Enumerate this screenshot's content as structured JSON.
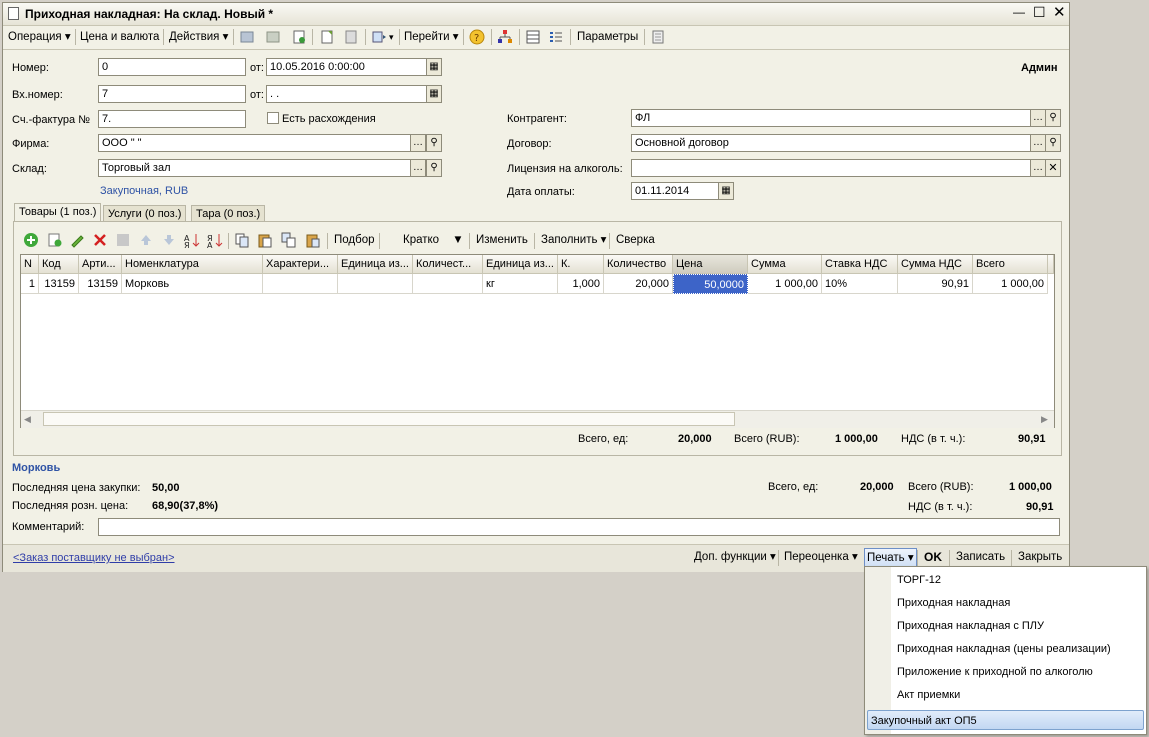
{
  "window": {
    "title": "Приходная накладная: На склад. Новый *"
  },
  "toolbar": {
    "operation": "Операция",
    "price_currency": "Цена и валюта",
    "actions": "Действия",
    "goto": "Перейти",
    "params": "Параметры"
  },
  "user": "Админ",
  "form": {
    "number_label": "Номер:",
    "number_value": "0",
    "from_label": "от:",
    "date_value": "10.05.2016  0:00:00",
    "in_number_label": "Вх.номер:",
    "in_number_value": "7",
    "from2_label": "от:",
    "in_date_value": ". . ",
    "invoice_label": "Сч.-фактура №",
    "invoice_value": "7.",
    "discrepancy_label": "Есть расхождения",
    "firm_label": "Фирма:",
    "firm_value": "ООО \"          \"",
    "warehouse_label": "Склад:",
    "warehouse_value": "Торговый зал",
    "purchase_link": "Закупочная, RUB",
    "counterparty_label": "Контрагент:",
    "counterparty_value": "ФЛ",
    "contract_label": "Договор:",
    "contract_value": "Основной договор",
    "alc_label": "Лицензия на алкоголь:",
    "alc_value": "",
    "paydate_label": "Дата оплаты:",
    "paydate_value": "01.11.2014"
  },
  "tabs": [
    "Товары (1 поз.)",
    "Услуги (0 поз.)",
    "Тара (0 поз.)"
  ],
  "table_toolbar": {
    "podbor": "Подбор",
    "kratko": "Кратко",
    "izmenit": "Изменить",
    "zapolnit": "Заполнить",
    "sverka": "Сверка"
  },
  "table": {
    "headers": [
      "N",
      "Код",
      "Арти...",
      "Номенклатура",
      "Характери...",
      "Единица из...",
      "Количест...",
      "Единица из...",
      "К.",
      "Количество",
      "Цена",
      "Сумма",
      "Ставка НДС",
      "Сумма НДС",
      "Всего"
    ],
    "rows": [
      [
        "1",
        "13159",
        "13159",
        "Морковь",
        "",
        "",
        "",
        "кг",
        "1,000",
        "20,000",
        "50,0000",
        "1 000,00",
        "10%",
        "90,91",
        "1 000,00"
      ]
    ]
  },
  "totals": {
    "qty_label": "Всего, ед:",
    "qty": "20,000",
    "sum_label": "Всего (RUB):",
    "sum": "1 000,00",
    "vat_label": "НДС (в т. ч.):",
    "vat": "90,91"
  },
  "item": {
    "name": "Морковь",
    "last_purchase_label": "Последняя цена закупки:",
    "last_purchase": "50,00",
    "last_retail_label": "Последняя розн. цена:",
    "last_retail": "68,90(37,8%)",
    "qty_label": "Всего, ед:",
    "qty": "20,000",
    "sum_label": "Всего (RUB):",
    "sum": "1 000,00",
    "vat_label": "НДС (в т. ч.):",
    "vat": "90,91"
  },
  "comment_label": "Комментарий:",
  "bottom": {
    "order_link": "<Заказ поставщику не выбран>",
    "dop": "Доп. функции",
    "pereocenka": "Переоценка",
    "pechat": "Печать",
    "ok": "OK",
    "save": "Записать",
    "close": "Закрыть"
  },
  "print_menu": [
    "ТОРГ-12",
    "Приходная накладная",
    "Приходная накладная с ПЛУ",
    "Приходная накладная (цены реализации)",
    "Приложение к приходной по алкоголю",
    "Акт приемки",
    "Закупочный акт ОП5"
  ]
}
